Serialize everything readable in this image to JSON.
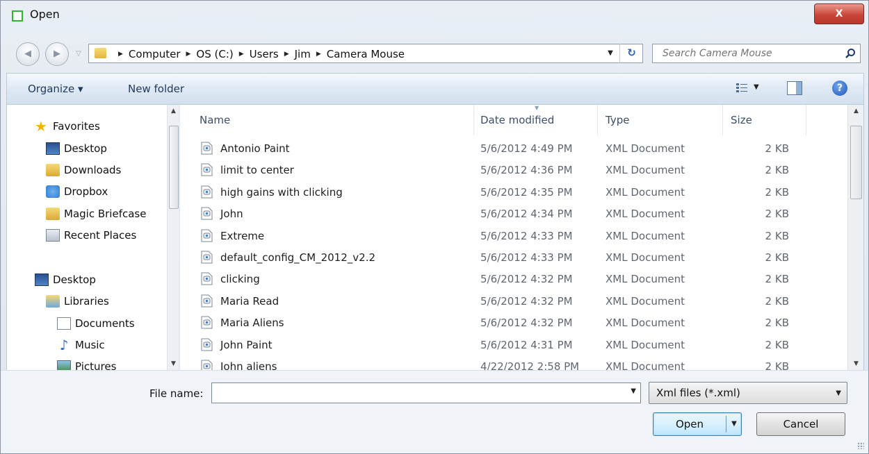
{
  "window": {
    "title": "Open",
    "close_label": "X"
  },
  "address": {
    "crumbs": [
      "Computer",
      "OS (C:)",
      "Users",
      "Jim",
      "Camera Mouse"
    ]
  },
  "search": {
    "placeholder": "Search Camera Mouse"
  },
  "toolbar": {
    "organize_label": "Organize ▾",
    "new_folder_label": "New folder",
    "help_label": "?"
  },
  "nav": {
    "favorites_header": "Favorites",
    "favorites": [
      "Desktop",
      "Downloads",
      "Dropbox",
      "Magic Briefcase",
      "Recent Places"
    ],
    "desktop_header": "Desktop",
    "libraries": "Libraries",
    "library_items": [
      "Documents",
      "Music",
      "Pictures"
    ]
  },
  "columns": {
    "name": "Name",
    "date": "Date modified",
    "type": "Type",
    "size": "Size"
  },
  "files": [
    {
      "name": "Antonio Paint",
      "date": "5/6/2012 4:49 PM",
      "type": "XML Document",
      "size": "2 KB"
    },
    {
      "name": "limit to center",
      "date": "5/6/2012 4:36 PM",
      "type": "XML Document",
      "size": "2 KB"
    },
    {
      "name": "high gains with clicking",
      "date": "5/6/2012 4:35 PM",
      "type": "XML Document",
      "size": "2 KB"
    },
    {
      "name": "John",
      "date": "5/6/2012 4:34 PM",
      "type": "XML Document",
      "size": "2 KB"
    },
    {
      "name": "Extreme",
      "date": "5/6/2012 4:33 PM",
      "type": "XML Document",
      "size": "2 KB"
    },
    {
      "name": "default_config_CM_2012_v2.2",
      "date": "5/6/2012 4:33 PM",
      "type": "XML Document",
      "size": "2 KB"
    },
    {
      "name": "clicking",
      "date": "5/6/2012 4:32 PM",
      "type": "XML Document",
      "size": "2 KB"
    },
    {
      "name": "Maria Read",
      "date": "5/6/2012 4:32 PM",
      "type": "XML Document",
      "size": "2 KB"
    },
    {
      "name": "Maria Aliens",
      "date": "5/6/2012 4:32 PM",
      "type": "XML Document",
      "size": "2 KB"
    },
    {
      "name": "John Paint",
      "date": "5/6/2012 4:31 PM",
      "type": "XML Document",
      "size": "2 KB"
    },
    {
      "name": "John aliens",
      "date": "4/22/2012 2:58 PM",
      "type": "XML Document",
      "size": "2 KB"
    }
  ],
  "bottom": {
    "file_name_label": "File name:",
    "file_name_value": "",
    "filter_label": "Xml files (*.xml)",
    "open_label": "Open",
    "cancel_label": "Cancel"
  },
  "colors": {
    "close_red": "#c9473a",
    "toolbar_text": "#1e395b",
    "accent_blue": "#3c7fb1"
  }
}
